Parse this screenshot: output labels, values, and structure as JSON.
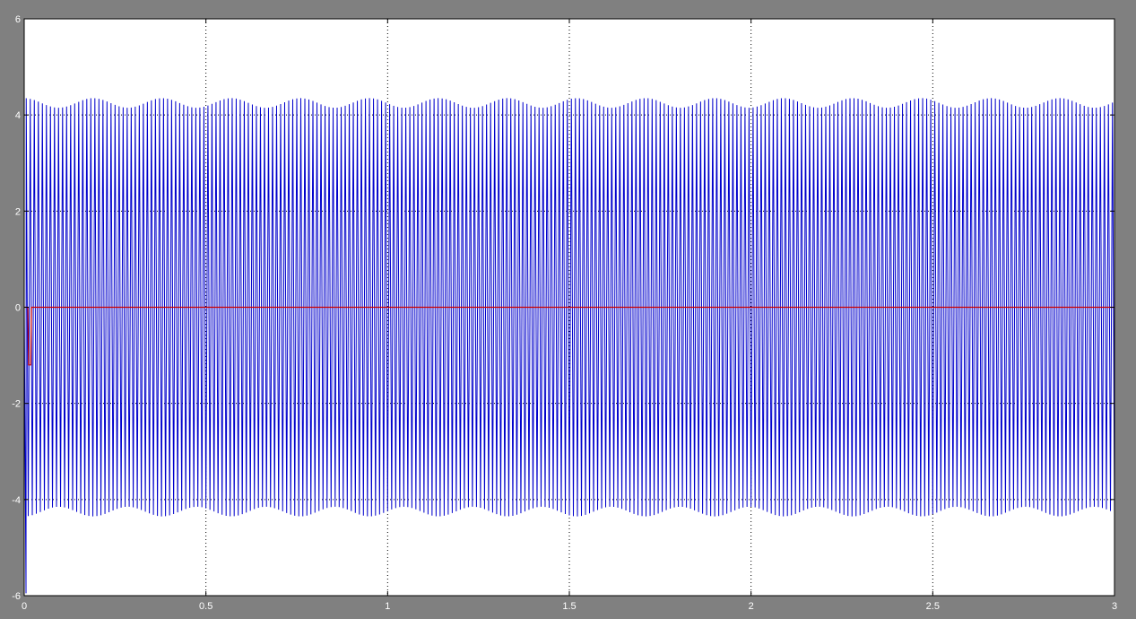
{
  "chart_data": {
    "type": "line",
    "xlim": [
      0,
      3
    ],
    "ylim": [
      -6,
      6
    ],
    "xticks": [
      "0",
      "0.5",
      "1",
      "1.5",
      "2",
      "2.5",
      "3"
    ],
    "xtick_values": [
      0,
      0.5,
      1,
      1.5,
      2,
      2.5,
      3
    ],
    "yticks": [
      "6",
      "4",
      "2",
      "0",
      "-2",
      "-4",
      "-6"
    ],
    "ytick_values": [
      6,
      4,
      2,
      0,
      -2,
      -4,
      -6
    ],
    "grid": true,
    "colors": {
      "figure_background": "#808080",
      "axes_background": "#ffffff",
      "grid": "#000000",
      "text": "#ffffff"
    },
    "series": [
      {
        "color": "#0000cc",
        "description": "high-frequency oscillation with beating envelope",
        "amplitude_max": 4.35,
        "amplitude_min": 4.15,
        "carrier_cycles_in_view": 270,
        "beat_period_s": 0.19,
        "initial_transient": {
          "t": 0.005,
          "min": -5.95
        }
      },
      {
        "color": "#cc0000",
        "description": "near-zero trace",
        "points": [
          [
            0,
            0
          ],
          [
            0.01,
            0
          ],
          [
            0.012,
            -1.2
          ],
          [
            0.018,
            -1.2
          ],
          [
            0.02,
            0
          ],
          [
            3,
            0
          ]
        ]
      }
    ]
  }
}
